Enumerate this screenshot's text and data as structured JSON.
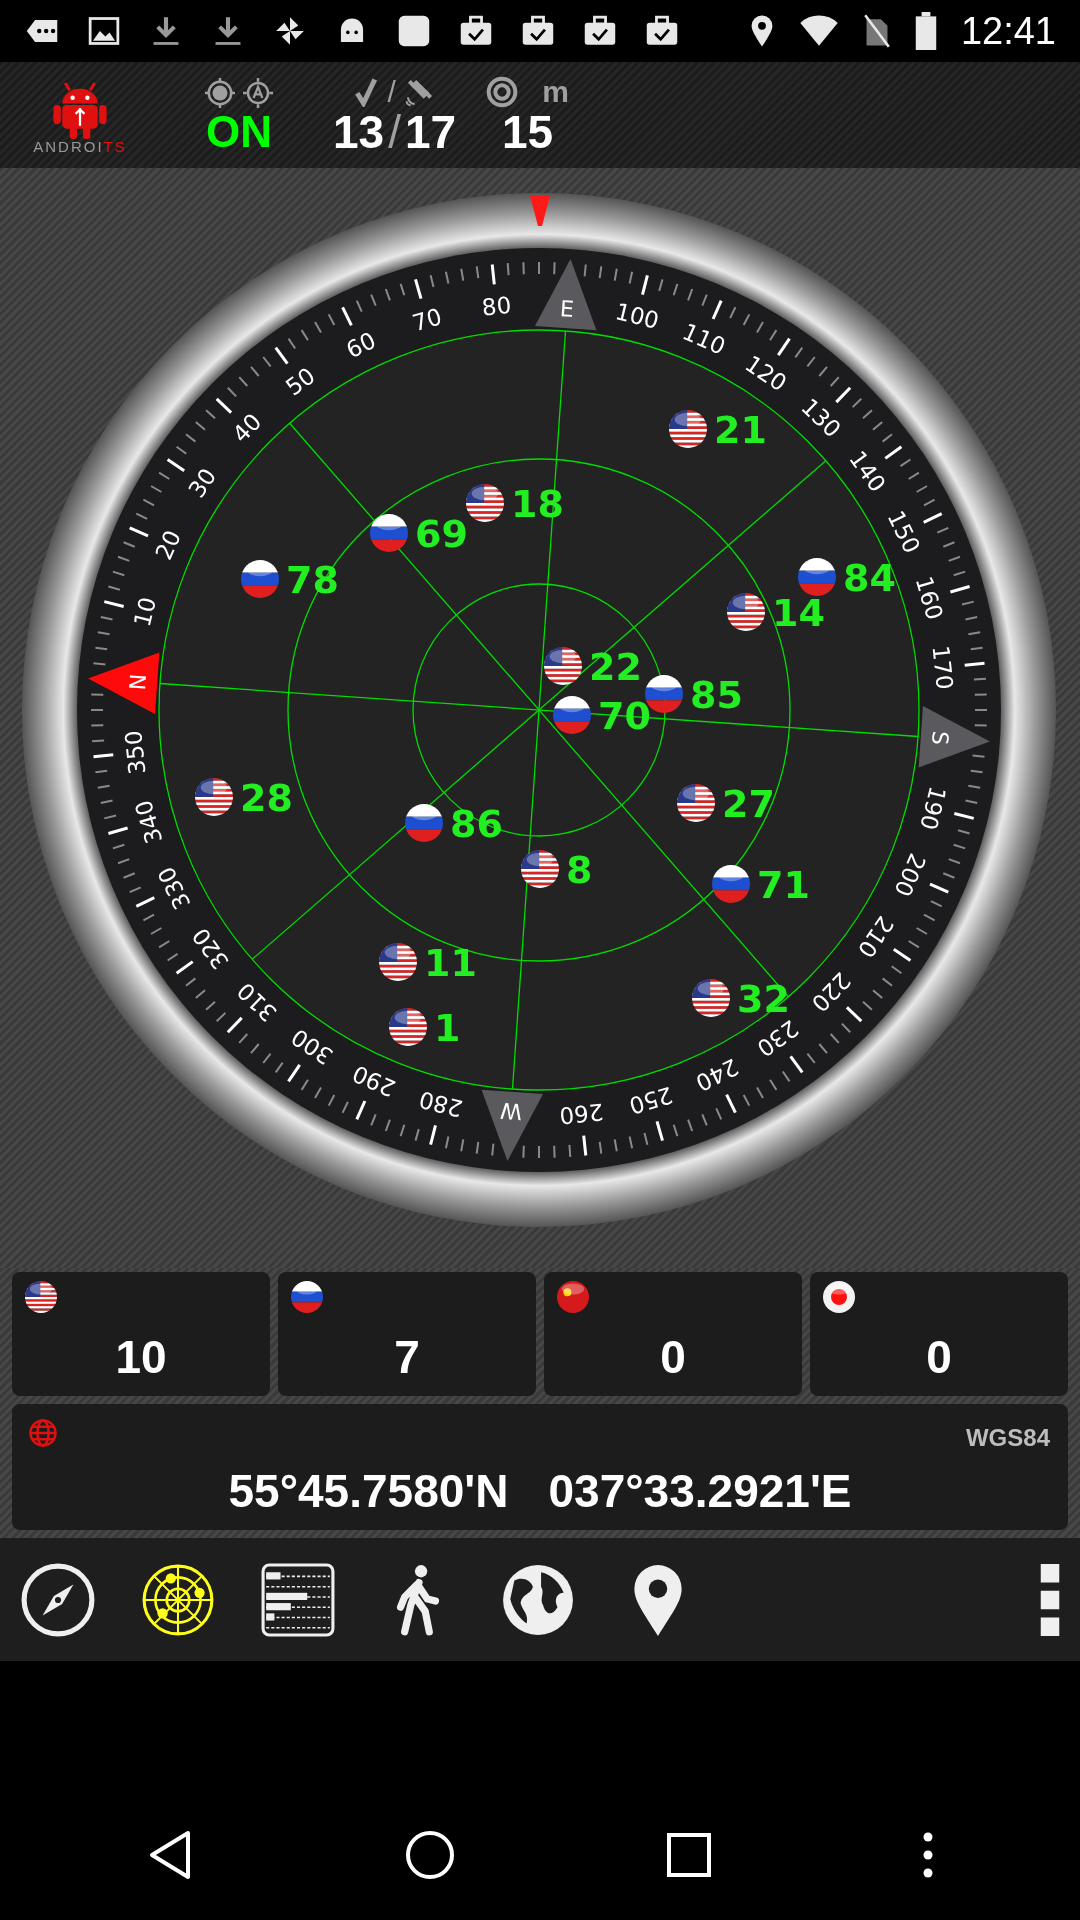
{
  "status_bar": {
    "time": "12:41"
  },
  "header": {
    "logo": {
      "text_main": "ANDROI",
      "text_accent": "TS"
    },
    "fix": {
      "value": "ON"
    },
    "satellites": {
      "separator_icon_row": "/",
      "used": "13",
      "separator": "/",
      "visible": "17"
    },
    "accuracy": {
      "unit": "m",
      "value": "15"
    }
  },
  "dial": {
    "marks": [
      {
        "text": "N",
        "kind": "north"
      },
      {
        "text": "10",
        "kind": "degree"
      },
      {
        "text": "20",
        "kind": "degree"
      },
      {
        "text": "30",
        "kind": "degree"
      },
      {
        "text": "40",
        "kind": "degree"
      },
      {
        "text": "50",
        "kind": "degree"
      },
      {
        "text": "60",
        "kind": "degree"
      },
      {
        "text": "70",
        "kind": "degree"
      },
      {
        "text": "80",
        "kind": "degree"
      },
      {
        "text": "E",
        "kind": "cardinal"
      },
      {
        "text": "100",
        "kind": "degree"
      },
      {
        "text": "110",
        "kind": "degree"
      },
      {
        "text": "120",
        "kind": "degree"
      },
      {
        "text": "130",
        "kind": "degree"
      },
      {
        "text": "140",
        "kind": "degree"
      },
      {
        "text": "150",
        "kind": "degree"
      },
      {
        "text": "160",
        "kind": "degree"
      },
      {
        "text": "170",
        "kind": "degree"
      },
      {
        "text": "S",
        "kind": "cardinal"
      },
      {
        "text": "190",
        "kind": "degree"
      },
      {
        "text": "200",
        "kind": "degree"
      },
      {
        "text": "210",
        "kind": "degree"
      },
      {
        "text": "220",
        "kind": "degree"
      },
      {
        "text": "230",
        "kind": "degree"
      },
      {
        "text": "240",
        "kind": "degree"
      },
      {
        "text": "250",
        "kind": "degree"
      },
      {
        "text": "260",
        "kind": "degree"
      },
      {
        "text": "W",
        "kind": "cardinal"
      },
      {
        "text": "280",
        "kind": "degree"
      },
      {
        "text": "290",
        "kind": "degree"
      },
      {
        "text": "300",
        "kind": "degree"
      },
      {
        "text": "310",
        "kind": "degree"
      },
      {
        "text": "320",
        "kind": "degree"
      },
      {
        "text": "330",
        "kind": "degree"
      },
      {
        "text": "340",
        "kind": "degree"
      },
      {
        "text": "350",
        "kind": "degree"
      }
    ]
  },
  "satellites": [
    {
      "number": "21",
      "kind": "gps"
    },
    {
      "number": "18",
      "kind": "gps"
    },
    {
      "number": "69",
      "kind": "glonass"
    },
    {
      "number": "78",
      "kind": "glonass"
    },
    {
      "number": "84",
      "kind": "glonass"
    },
    {
      "number": "14",
      "kind": "gps"
    },
    {
      "number": "22",
      "kind": "gps"
    },
    {
      "number": "70",
      "kind": "glonass"
    },
    {
      "number": "85",
      "kind": "glonass"
    },
    {
      "number": "28",
      "kind": "gps"
    },
    {
      "number": "86",
      "kind": "glonass"
    },
    {
      "number": "27",
      "kind": "gps"
    },
    {
      "number": "8",
      "kind": "gps"
    },
    {
      "number": "71",
      "kind": "glonass"
    },
    {
      "number": "11",
      "kind": "gps"
    },
    {
      "number": "1",
      "kind": "gps"
    },
    {
      "number": "32",
      "kind": "gps"
    }
  ],
  "system_counts": [
    {
      "kind": "gps",
      "count": "10"
    },
    {
      "kind": "glonass",
      "count": "7"
    },
    {
      "kind": "beidou",
      "count": "0"
    },
    {
      "kind": "qzss",
      "count": "0"
    }
  ],
  "position": {
    "datum": "WGS84",
    "latitude": "55°45.7580'N",
    "longitude": "037°33.2921'E"
  },
  "toolbar": [
    {
      "kind": "compass",
      "selected": false
    },
    {
      "kind": "radar",
      "selected": true
    },
    {
      "kind": "signal",
      "selected": false
    },
    {
      "kind": "walker",
      "selected": false
    },
    {
      "kind": "globe",
      "selected": false
    },
    {
      "kind": "pin",
      "selected": false
    },
    {
      "kind": "menu",
      "selected": false
    }
  ]
}
